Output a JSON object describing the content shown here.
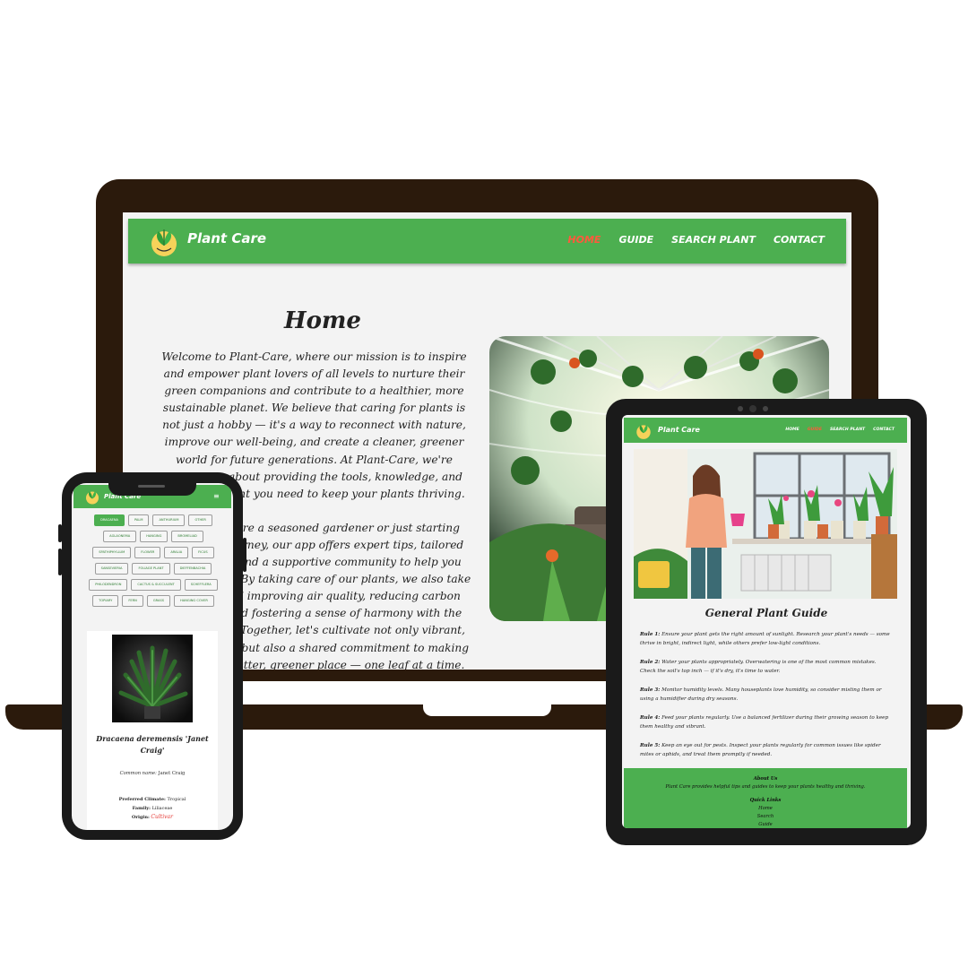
{
  "brand": {
    "name": "Plant Care",
    "logo_text": "PLANT CARE"
  },
  "laptop": {
    "nav": {
      "home": "HOME",
      "guide": "GUIDE",
      "search": "SEARCH PLANT",
      "contact": "CONTACT"
    },
    "heading": "Home",
    "paragraph1": "Welcome to Plant-Care, where our mission is to inspire and empower plant lovers of all levels to nurture their green companions and contribute to a healthier, more sustainable planet. We believe that caring for plants is not just a hobby — it's a way to reconnect with nature, improve our well-being, and create a cleaner, greener world for future generations. At Plant-Care, we're passionate about providing the tools, knowledge, and encouragement you need to keep your plants thriving.",
    "paragraph2": "Whether you're a seasoned gardener or just starting your plant journey, our app offers expert tips, tailored care guides, and a supportive community to help you along the way. By taking care of our plants, we also take a step toward improving air quality, reducing carbon footprints, and fostering a sense of harmony with the environment. Together, let's cultivate not only vibrant, healthy plants but also a shared commitment to making the world a better, greener place — one leaf at a time."
  },
  "tablet": {
    "nav": {
      "home": "HOME",
      "guide": "GUIDE",
      "search": "SEARCH PLANT",
      "contact": "CONTACT"
    },
    "heading": "General Plant Guide",
    "rules": [
      {
        "label": "Rule 1:",
        "text": "Ensure your plant gets the right amount of sunlight. Research your plant's needs — some thrive in bright, indirect light, while others prefer low-light conditions."
      },
      {
        "label": "Rule 2:",
        "text": "Water your plants appropriately. Overwatering is one of the most common mistakes. Check the soil's top inch — if it's dry, it's time to water."
      },
      {
        "label": "Rule 3:",
        "text": "Monitor humidity levels. Many houseplants love humidity, so consider misting them or using a humidifier during dry seasons."
      },
      {
        "label": "Rule 4:",
        "text": "Feed your plants regularly. Use a balanced fertilizer during their growing season to keep them healthy and vibrant."
      },
      {
        "label": "Rule 5:",
        "text": "Keep an eye out for pests. Inspect your plants regularly for common issues like spider mites or aphids, and treat them promptly if needed."
      }
    ],
    "footer": {
      "about_title": "About Us",
      "about_text": "Plant Care provides helpful tips and guides to keep your plants healthy and thriving.",
      "links_title": "Quick Links",
      "links": [
        "Home",
        "Search",
        "Guide"
      ]
    }
  },
  "phone": {
    "menu_icon": "≡",
    "tags": [
      "Dracaena",
      "Palm",
      "Anthurium",
      "Other",
      "Aglaonema",
      "Hanging",
      "Bromeliad",
      "Spathiphyllum",
      "Flower",
      "Aralia",
      "Ficus",
      "Sansevieria",
      "Foliage plant",
      "Dieffenbachia",
      "Philodendron",
      "Cactus & Succulent",
      "Schefflera",
      "Topiary",
      "Fern",
      "Grass",
      "Hanging Cover"
    ],
    "plant": {
      "name": "Dracaena deremensis 'Janet Craig'",
      "common_label": "Common name:",
      "common_value": "Janet Craig",
      "climate_label": "Preferred Climate:",
      "climate_value": "Tropical",
      "family_label": "Family:",
      "family_value": "Liliaceae",
      "origin_label": "Origin:",
      "origin_value": "Cultivar"
    }
  },
  "colors": {
    "green": "#4caf50",
    "active": "#ff5a3c",
    "device": "#2b1a0c"
  }
}
